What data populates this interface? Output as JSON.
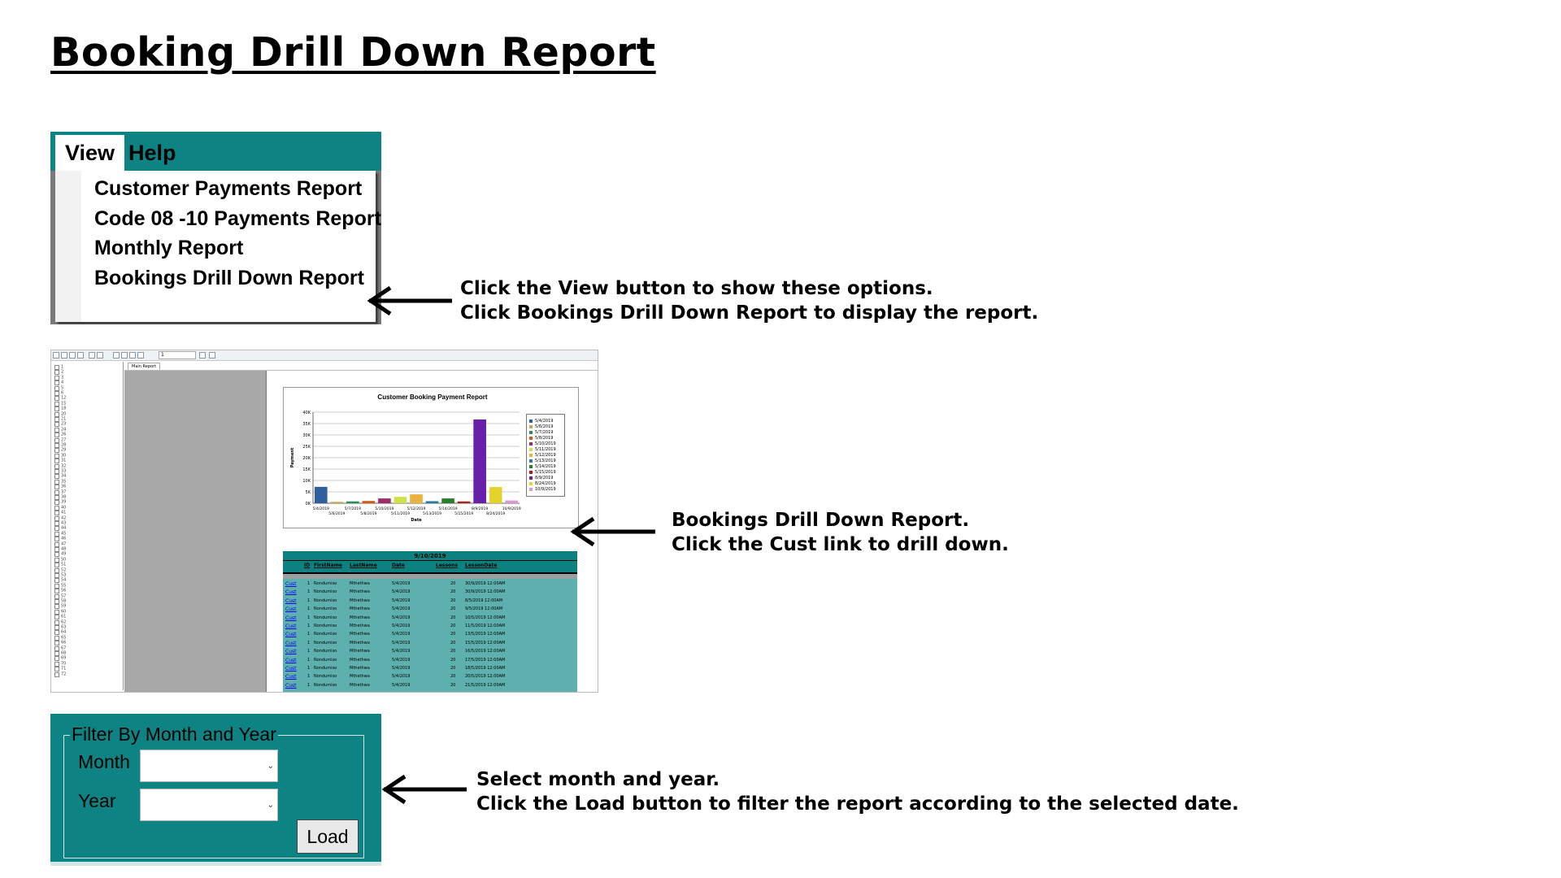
{
  "page_title": "Booking Drill Down Report",
  "menu": {
    "view_label": "View",
    "help_label": "Help",
    "options": [
      "Customer Payments Report",
      "Code 08 -10 Payments Report",
      "Monthly Report",
      "Bookings Drill Down Report"
    ]
  },
  "notes": {
    "menu_line1": "Click the View button to show these options.",
    "menu_line2": "Click Bookings Drill Down Report to display the report.",
    "report_line1": "Bookings Drill Down Report.",
    "report_line2": "Click the Cust link to drill down.",
    "filter_line1": "Select month and year.",
    "filter_line2": "Click the Load button to filter the report according to the selected date."
  },
  "viewer": {
    "page_number": "1",
    "tab_label": "Main Report",
    "tree_items": [
      "1",
      "2",
      "3",
      "4",
      "5",
      "6",
      "12",
      "15",
      "18",
      "20",
      "21",
      "23",
      "24",
      "26",
      "27",
      "28",
      "29",
      "30",
      "31",
      "32",
      "33",
      "34",
      "35",
      "36",
      "37",
      "38",
      "39",
      "40",
      "41",
      "42",
      "43",
      "44",
      "45",
      "46",
      "47",
      "48",
      "49",
      "50",
      "51",
      "52",
      "53",
      "54",
      "55",
      "56",
      "57",
      "58",
      "59",
      "60",
      "61",
      "62",
      "63",
      "64",
      "65",
      "66",
      "67",
      "68",
      "69",
      "70",
      "71",
      "72"
    ]
  },
  "chart_data": {
    "type": "bar",
    "title": "Customer Booking Payment Report",
    "xlabel": "Date",
    "ylabel": "Payment",
    "ylim": [
      0,
      40000
    ],
    "yticks": [
      "0K",
      "5K",
      "10K",
      "15K",
      "20K",
      "25K",
      "30K",
      "35K",
      "40K"
    ],
    "categories": [
      "5/4/2019",
      "5/6/2019",
      "5/7/2019",
      "5/8/2019",
      "5/10/2019",
      "5/11/2019",
      "5/12/2019",
      "5/13/2019",
      "5/14/2019",
      "5/15/2019",
      "8/9/2019",
      "8/24/2019",
      "10/9/2019"
    ],
    "values": [
      7200,
      600,
      800,
      1000,
      2100,
      2800,
      3900,
      900,
      2100,
      800,
      36800,
      7100,
      1200
    ],
    "colors": [
      "#2e5fa1",
      "#c9a65a",
      "#2a8f55",
      "#d45a16",
      "#a02a6a",
      "#cfe04a",
      "#e8b340",
      "#2a7aa0",
      "#2a7d2a",
      "#b02020",
      "#6a1fa8",
      "#e3d32a",
      "#d99acf"
    ]
  },
  "table": {
    "date_header": "9/10/2019",
    "columns": [
      "ID",
      "FirstName",
      "LastName",
      "Date",
      "Lessons",
      "LessonDate"
    ],
    "link_label": "Cust",
    "rows": [
      [
        "1",
        "Nondumiso",
        "Mthethwa",
        "5/4/2019",
        "20",
        "30/9/2019 12:00AM"
      ],
      [
        "1",
        "Nondumiso",
        "Mthethwa",
        "5/4/2019",
        "20",
        "30/9/2019 12:00AM"
      ],
      [
        "1",
        "Nondumiso",
        "Mthethwa",
        "5/4/2019",
        "20",
        "8/5/2019 12:00AM"
      ],
      [
        "1",
        "Nondumiso",
        "Mthethwa",
        "5/4/2019",
        "20",
        "9/5/2019 12:00AM"
      ],
      [
        "1",
        "Nondumiso",
        "Mthethwa",
        "5/4/2019",
        "20",
        "10/5/2019 12:00AM"
      ],
      [
        "1",
        "Nondumiso",
        "Mthethwa",
        "5/4/2019",
        "20",
        "11/5/2019 12:00AM"
      ],
      [
        "1",
        "Nondumiso",
        "Mthethwa",
        "5/4/2019",
        "20",
        "13/5/2019 12:00AM"
      ],
      [
        "1",
        "Nondumiso",
        "Mthethwa",
        "5/4/2019",
        "20",
        "15/5/2019 12:00AM"
      ],
      [
        "1",
        "Nondumiso",
        "Mthethwa",
        "5/4/2019",
        "20",
        "16/5/2019 12:00AM"
      ],
      [
        "1",
        "Nondumiso",
        "Mthethwa",
        "5/4/2019",
        "20",
        "17/5/2019 12:00AM"
      ],
      [
        "1",
        "Nondumiso",
        "Mthethwa",
        "5/4/2019",
        "20",
        "18/5/2019 12:00AM"
      ],
      [
        "1",
        "Nondumiso",
        "Mthethwa",
        "5/4/2019",
        "20",
        "20/5/2019 12:00AM"
      ],
      [
        "1",
        "Nondumiso",
        "Mthethwa",
        "5/4/2019",
        "20",
        "21/5/2019 12:00AM"
      ]
    ]
  },
  "filter": {
    "group_title": "Filter By Month and Year",
    "month_label": "Month",
    "year_label": "Year",
    "month_value": "",
    "year_value": "",
    "load_label": "Load"
  }
}
